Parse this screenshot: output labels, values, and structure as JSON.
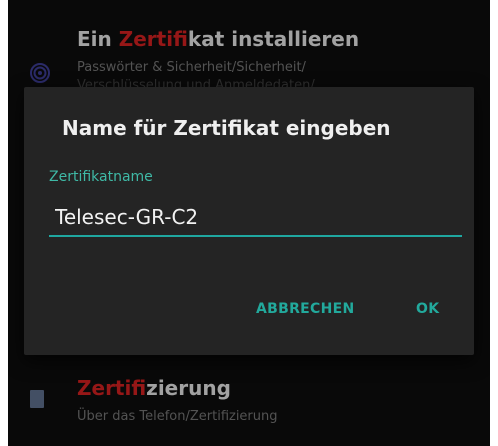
{
  "background_list": {
    "item1": {
      "title_highlight": "Zertif",
      "title_rest_before": "Ein ",
      "title_rest_after": "ikat installieren",
      "subtitle": "Passwörter & Sicherheit/Sicherheit/",
      "subtitle2": "Verschlüsselung und Anmeldedaten/",
      "icon": "fingerprint-icon"
    },
    "item2": {
      "title_highlight": "Zertifi",
      "title_rest_after": "zierung",
      "subtitle": "Über das Telefon/Zertifizierung",
      "icon": "document-icon"
    }
  },
  "dialog": {
    "title": "Name für Zertifikat eingeben",
    "field_label": "Zertifikatname",
    "field_value": "Telesec-GR-C2",
    "cancel_label": "ABBRECHEN",
    "ok_label": "OK"
  },
  "colors": {
    "accent": "#22a99c",
    "highlight": "#c81f1f",
    "dialog_bg": "#242424",
    "screen_bg": "#0d0d0d"
  }
}
